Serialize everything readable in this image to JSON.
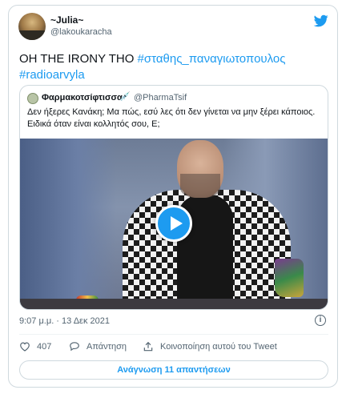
{
  "author": {
    "display_name": "~Julia~",
    "handle": "@lakoukaracha"
  },
  "tweet": {
    "text": "OH THE IRONY THO",
    "hashtags": [
      "#σταθης_παναγιωτοπουλος",
      "#radioarvyla"
    ]
  },
  "quoted": {
    "display_name": "Φαρμακοτσίφτισσα",
    "badge_emoji": "💉",
    "handle": "@PharmaTsif",
    "text": "Δεν ήξερες Κανάκη; Μα πώς, εσύ λες ότι δεν γίνεται να μην ξέρει κάποιος. Ειδικά όταν είναι κολλητός σου, Ε;"
  },
  "meta": {
    "timestamp": "9:07 μ.μ. · 13 Δεκ 2021",
    "info_glyph": "i"
  },
  "actions": {
    "like_count": "407",
    "reply_label": "Απάντηση",
    "share_label": "Κοινοποίηση αυτού του Tweet"
  },
  "replies_button_label": "Ανάγνωση 11 απαντήσεων",
  "colors": {
    "accent": "#1d9bf0",
    "text": "#0f1419",
    "muted": "#536471",
    "border": "#cfd9de"
  },
  "icons": [
    "twitter-bird-icon",
    "play-icon",
    "heart-icon",
    "reply-bubble-icon",
    "share-icon",
    "info-icon",
    "syringe-emoji"
  ]
}
